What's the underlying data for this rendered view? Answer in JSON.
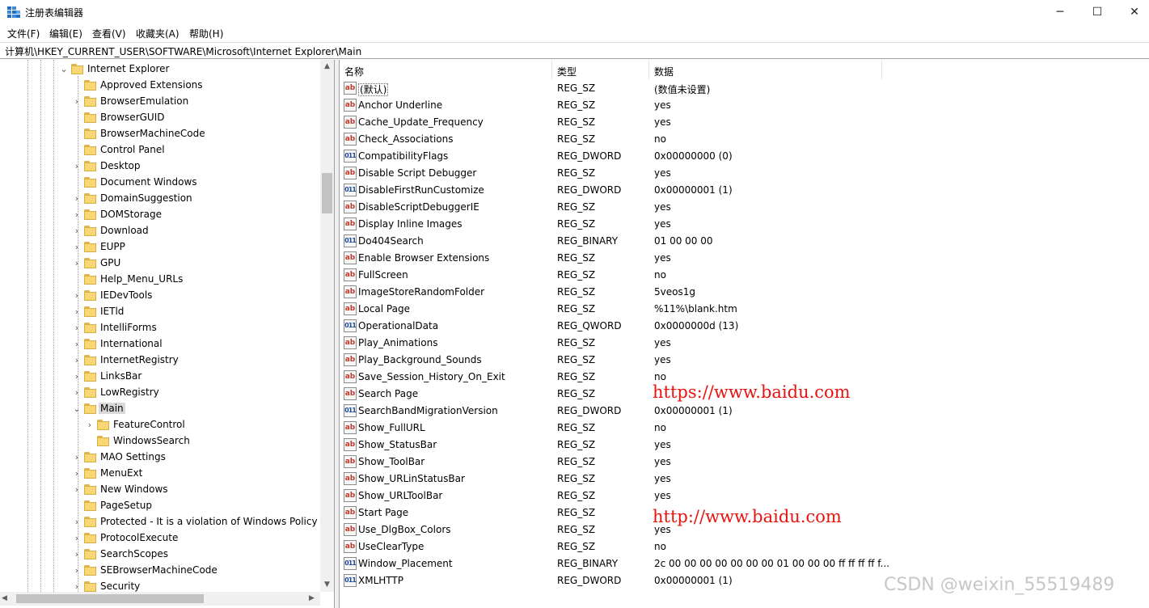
{
  "window": {
    "title": "注册表编辑器",
    "controls": {
      "minimize": "─",
      "maximize": "☐",
      "close": "✕"
    }
  },
  "menu": [
    "文件(F)",
    "编辑(E)",
    "查看(V)",
    "收藏夹(A)",
    "帮助(H)"
  ],
  "address": "计算机\\HKEY_CURRENT_USER\\SOFTWARE\\Microsoft\\Internet Explorer\\Main",
  "tree": {
    "items": [
      {
        "label": "Internet Explorer",
        "level": 0,
        "expander": "expanded"
      },
      {
        "label": "Approved Extensions",
        "level": 1,
        "expander": "none"
      },
      {
        "label": "BrowserEmulation",
        "level": 1,
        "expander": "collapsed"
      },
      {
        "label": "BrowserGUID",
        "level": 1,
        "expander": "none"
      },
      {
        "label": "BrowserMachineCode",
        "level": 1,
        "expander": "none"
      },
      {
        "label": "Control Panel",
        "level": 1,
        "expander": "none"
      },
      {
        "label": "Desktop",
        "level": 1,
        "expander": "collapsed"
      },
      {
        "label": "Document Windows",
        "level": 1,
        "expander": "none"
      },
      {
        "label": "DomainSuggestion",
        "level": 1,
        "expander": "collapsed"
      },
      {
        "label": "DOMStorage",
        "level": 1,
        "expander": "collapsed"
      },
      {
        "label": "Download",
        "level": 1,
        "expander": "collapsed"
      },
      {
        "label": "EUPP",
        "level": 1,
        "expander": "collapsed"
      },
      {
        "label": "GPU",
        "level": 1,
        "expander": "collapsed"
      },
      {
        "label": "Help_Menu_URLs",
        "level": 1,
        "expander": "none"
      },
      {
        "label": "IEDevTools",
        "level": 1,
        "expander": "collapsed"
      },
      {
        "label": "IETld",
        "level": 1,
        "expander": "collapsed"
      },
      {
        "label": "IntelliForms",
        "level": 1,
        "expander": "collapsed"
      },
      {
        "label": "International",
        "level": 1,
        "expander": "collapsed"
      },
      {
        "label": "InternetRegistry",
        "level": 1,
        "expander": "collapsed"
      },
      {
        "label": "LinksBar",
        "level": 1,
        "expander": "collapsed"
      },
      {
        "label": "LowRegistry",
        "level": 1,
        "expander": "collapsed"
      },
      {
        "label": "Main",
        "level": 1,
        "expander": "expanded",
        "selected": true
      },
      {
        "label": "FeatureControl",
        "level": 2,
        "expander": "collapsed"
      },
      {
        "label": "WindowsSearch",
        "level": 2,
        "expander": "none"
      },
      {
        "label": "MAO Settings",
        "level": 1,
        "expander": "collapsed"
      },
      {
        "label": "MenuExt",
        "level": 1,
        "expander": "collapsed"
      },
      {
        "label": "New Windows",
        "level": 1,
        "expander": "collapsed"
      },
      {
        "label": "PageSetup",
        "level": 1,
        "expander": "none"
      },
      {
        "label": "Protected - It is a violation of Windows Policy t",
        "level": 1,
        "expander": "collapsed"
      },
      {
        "label": "ProtocolExecute",
        "level": 1,
        "expander": "collapsed"
      },
      {
        "label": "SearchScopes",
        "level": 1,
        "expander": "collapsed"
      },
      {
        "label": "SEBrowserMachineCode",
        "level": 1,
        "expander": "collapsed"
      },
      {
        "label": "Security",
        "level": 1,
        "expander": "collapsed"
      }
    ]
  },
  "list": {
    "columns": [
      "名称",
      "类型",
      "数据"
    ],
    "rows": [
      {
        "name": "(默认)",
        "type": "REG_SZ",
        "data": "(数值未设置)",
        "icon": "ab"
      },
      {
        "name": "Anchor Underline",
        "type": "REG_SZ",
        "data": "yes",
        "icon": "ab"
      },
      {
        "name": "Cache_Update_Frequency",
        "type": "REG_SZ",
        "data": "yes",
        "icon": "ab"
      },
      {
        "name": "Check_Associations",
        "type": "REG_SZ",
        "data": "no",
        "icon": "ab"
      },
      {
        "name": "CompatibilityFlags",
        "type": "REG_DWORD",
        "data": "0x00000000 (0)",
        "icon": "bin"
      },
      {
        "name": "Disable Script Debugger",
        "type": "REG_SZ",
        "data": "yes",
        "icon": "ab"
      },
      {
        "name": "DisableFirstRunCustomize",
        "type": "REG_DWORD",
        "data": "0x00000001 (1)",
        "icon": "bin"
      },
      {
        "name": "DisableScriptDebuggerIE",
        "type": "REG_SZ",
        "data": "yes",
        "icon": "ab"
      },
      {
        "name": "Display Inline Images",
        "type": "REG_SZ",
        "data": "yes",
        "icon": "ab"
      },
      {
        "name": "Do404Search",
        "type": "REG_BINARY",
        "data": "01 00 00 00",
        "icon": "bin"
      },
      {
        "name": "Enable Browser Extensions",
        "type": "REG_SZ",
        "data": "yes",
        "icon": "ab"
      },
      {
        "name": "FullScreen",
        "type": "REG_SZ",
        "data": "no",
        "icon": "ab"
      },
      {
        "name": "ImageStoreRandomFolder",
        "type": "REG_SZ",
        "data": "5veos1g",
        "icon": "ab"
      },
      {
        "name": "Local Page",
        "type": "REG_SZ",
        "data": "%11%\\blank.htm",
        "icon": "ab"
      },
      {
        "name": "OperationalData",
        "type": "REG_QWORD",
        "data": "0x0000000d (13)",
        "icon": "bin"
      },
      {
        "name": "Play_Animations",
        "type": "REG_SZ",
        "data": "yes",
        "icon": "ab"
      },
      {
        "name": "Play_Background_Sounds",
        "type": "REG_SZ",
        "data": "yes",
        "icon": "ab"
      },
      {
        "name": "Save_Session_History_On_Exit",
        "type": "REG_SZ",
        "data": "no",
        "icon": "ab"
      },
      {
        "name": "Search Page",
        "type": "REG_SZ",
        "data": "",
        "icon": "ab"
      },
      {
        "name": "SearchBandMigrationVersion",
        "type": "REG_DWORD",
        "data": "0x00000001 (1)",
        "icon": "bin"
      },
      {
        "name": "Show_FullURL",
        "type": "REG_SZ",
        "data": "no",
        "icon": "ab"
      },
      {
        "name": "Show_StatusBar",
        "type": "REG_SZ",
        "data": "yes",
        "icon": "ab"
      },
      {
        "name": "Show_ToolBar",
        "type": "REG_SZ",
        "data": "yes",
        "icon": "ab"
      },
      {
        "name": "Show_URLinStatusBar",
        "type": "REG_SZ",
        "data": "yes",
        "icon": "ab"
      },
      {
        "name": "Show_URLToolBar",
        "type": "REG_SZ",
        "data": "yes",
        "icon": "ab"
      },
      {
        "name": "Start Page",
        "type": "REG_SZ",
        "data": "",
        "icon": "ab"
      },
      {
        "name": "Use_DlgBox_Colors",
        "type": "REG_SZ",
        "data": "yes",
        "icon": "ab"
      },
      {
        "name": "UseClearType",
        "type": "REG_SZ",
        "data": "no",
        "icon": "ab"
      },
      {
        "name": "Window_Placement",
        "type": "REG_BINARY",
        "data": "2c 00 00 00 00 00 00 00 01 00 00 00 ff ff ff ff f...",
        "icon": "bin"
      },
      {
        "name": "XMLHTTP",
        "type": "REG_DWORD",
        "data": "0x00000001 (1)",
        "icon": "bin"
      }
    ]
  },
  "overlays": {
    "search_page_url": "https://www.baidu.com",
    "start_page_url": "http://www.baidu.com",
    "watermark": "CSDN @weixin_55519489",
    "url_color": "#e8130f"
  }
}
